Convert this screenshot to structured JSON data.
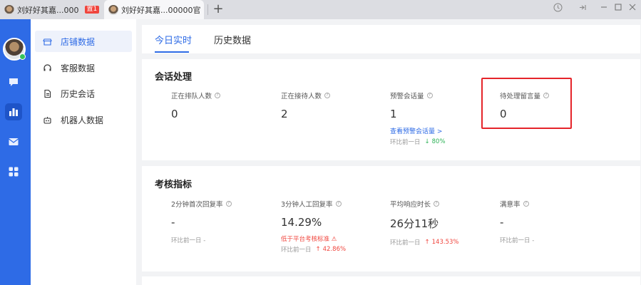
{
  "tabs": [
    {
      "title": "刘好好其嘉...000",
      "badge": "置1",
      "active": false
    },
    {
      "title": "刘好好其嘉...00000官",
      "active": true
    }
  ],
  "window_controls": [
    "help-icon",
    "pin-icon",
    "minimize-icon",
    "maximize-icon",
    "close-icon"
  ],
  "rail": {
    "icons": [
      "chat-icon",
      "chart-icon",
      "mail-icon",
      "apps-icon"
    ],
    "active": "chart-icon"
  },
  "subnav": {
    "items": [
      {
        "label": "店铺数据",
        "icon": "store-icon",
        "active": true
      },
      {
        "label": "客服数据",
        "icon": "headset-icon",
        "active": false
      },
      {
        "label": "历史会话",
        "icon": "document-icon",
        "active": false
      },
      {
        "label": "机器人数据",
        "icon": "robot-icon",
        "active": false
      }
    ]
  },
  "main": {
    "tabs": [
      {
        "label": "今日实时",
        "active": true
      },
      {
        "label": "历史数据",
        "active": false
      }
    ],
    "session": {
      "title": "会话处理",
      "metrics": [
        {
          "label": "正在排队人数",
          "value": "0"
        },
        {
          "label": "正在接待人数",
          "value": "2"
        },
        {
          "label": "预警会话量",
          "value": "1",
          "link": "查看预警会话量 >",
          "compare_label": "环比前一日",
          "compare_value": "80%",
          "compare_dir": "down"
        },
        {
          "label": "待处理留言量",
          "value": "0"
        }
      ]
    },
    "kpi": {
      "title": "考核指标",
      "metrics": [
        {
          "label": "2分钟首次回复率",
          "value": "-",
          "compare_label": "环比前一日 -"
        },
        {
          "label": "3分钟人工回复率",
          "value": "14.29%",
          "warning": "低于平台考核标准 ⚠",
          "compare_label": "环比前一日",
          "compare_value": "42.86%",
          "compare_dir": "up"
        },
        {
          "label": "平均响应时长",
          "value": "26分11秒",
          "compare_label": "环比前一日",
          "compare_value": "143.53%",
          "compare_dir": "up"
        },
        {
          "label": "满意率",
          "value": "-",
          "compare_label": "环比前一日 -"
        }
      ]
    }
  },
  "colors": {
    "accent": "#2e6be6",
    "rail": "#2e6be6",
    "warning": "#f0453d",
    "positive": "#2db257",
    "highlight": "#e5242a"
  }
}
